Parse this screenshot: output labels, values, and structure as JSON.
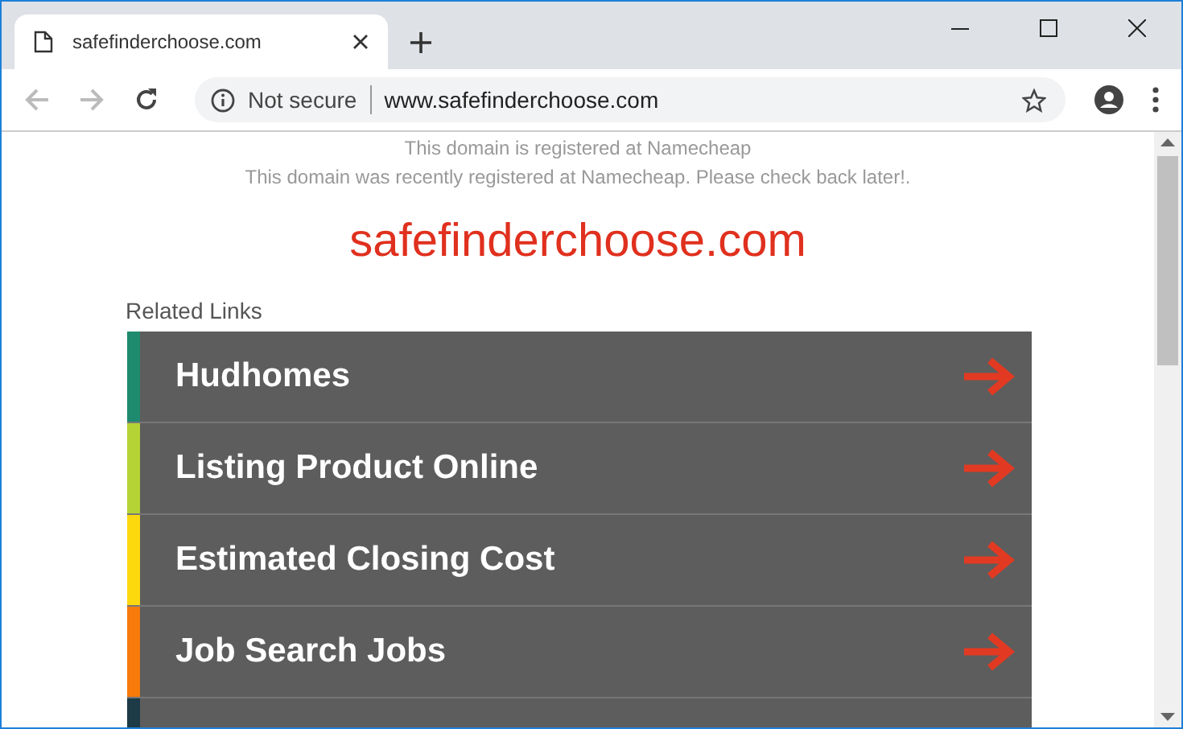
{
  "tab": {
    "title": "safefinderchoose.com"
  },
  "address_bar": {
    "security": "Not secure",
    "url": "www.safefinderchoose.com"
  },
  "page": {
    "notices": [
      "This domain is registered at Namecheap",
      "This domain was recently registered at Namecheap. Please check back later!."
    ],
    "domain": "safefinderchoose.com",
    "related_heading": "Related Links",
    "links": [
      {
        "label": "Hudhomes",
        "color": "#1e8a6e"
      },
      {
        "label": "Listing Product Online",
        "color": "#b5d334"
      },
      {
        "label": "Estimated Closing Cost",
        "color": "#fcd80f"
      },
      {
        "label": "Job Search Jobs",
        "color": "#f77a0a"
      },
      {
        "color": "#1c3b46"
      }
    ]
  }
}
